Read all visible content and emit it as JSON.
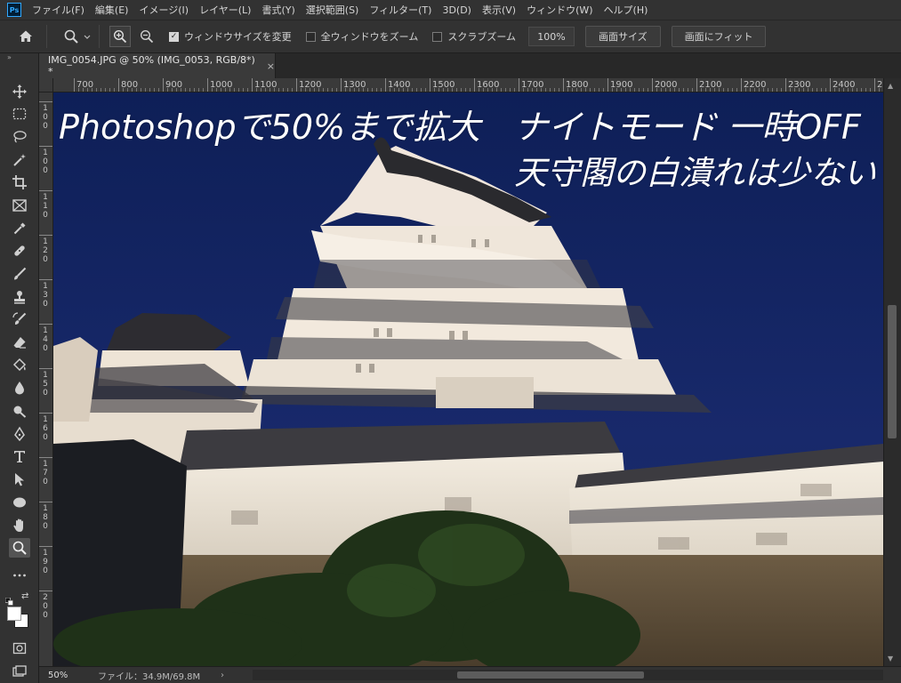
{
  "menubar": {
    "logo": "Ps",
    "items": [
      "ファイル(F)",
      "編集(E)",
      "イメージ(I)",
      "レイヤー(L)",
      "書式(Y)",
      "選択範囲(S)",
      "フィルター(T)",
      "3D(D)",
      "表示(V)",
      "ウィンドウ(W)",
      "ヘルプ(H)"
    ]
  },
  "options": {
    "resize_windows_label": "ウィンドウサイズを変更",
    "resize_windows_checked": true,
    "zoom_all_label": "全ウィンドウをズーム",
    "zoom_all_checked": false,
    "scrubby_zoom_label": "スクラブズーム",
    "scrubby_zoom_checked": false,
    "zoom_percent": "100%",
    "fit_screen_label": "画面サイズ",
    "fill_screen_label": "画面にフィット"
  },
  "document": {
    "tab_title": "IMG_0054.JPG @ 50% (IMG_0053, RGB/8*) *",
    "close_glyph": "×"
  },
  "ruler": {
    "top_labels": [
      "700",
      "800",
      "900",
      "1000",
      "1100",
      "1200",
      "1300",
      "1400",
      "1500",
      "1600",
      "1700",
      "1800",
      "1900",
      "2000",
      "2100",
      "2200",
      "2300",
      "2400",
      "2"
    ],
    "left_labels": [
      "1\n0\n0",
      "1\n0\n0",
      "1\n1\n0",
      "1\n2\n0",
      "1\n3\n0",
      "1\n4\n0",
      "1\n5\n0",
      "1\n6\n0",
      "1\n7\n0",
      "1\n8\n0",
      "1\n9\n0",
      "2\n0\n0"
    ]
  },
  "canvas": {
    "overlay_line1": "Photoshopで50%まで拡大　ナイトモード 一時OFF",
    "overlay_line2": "天守閣の白潰れは少ない",
    "sky_color": "#13276a"
  },
  "status": {
    "zoom": "50%",
    "file_info": "ファイル：34.9M/69.8M",
    "arrow": "›"
  }
}
